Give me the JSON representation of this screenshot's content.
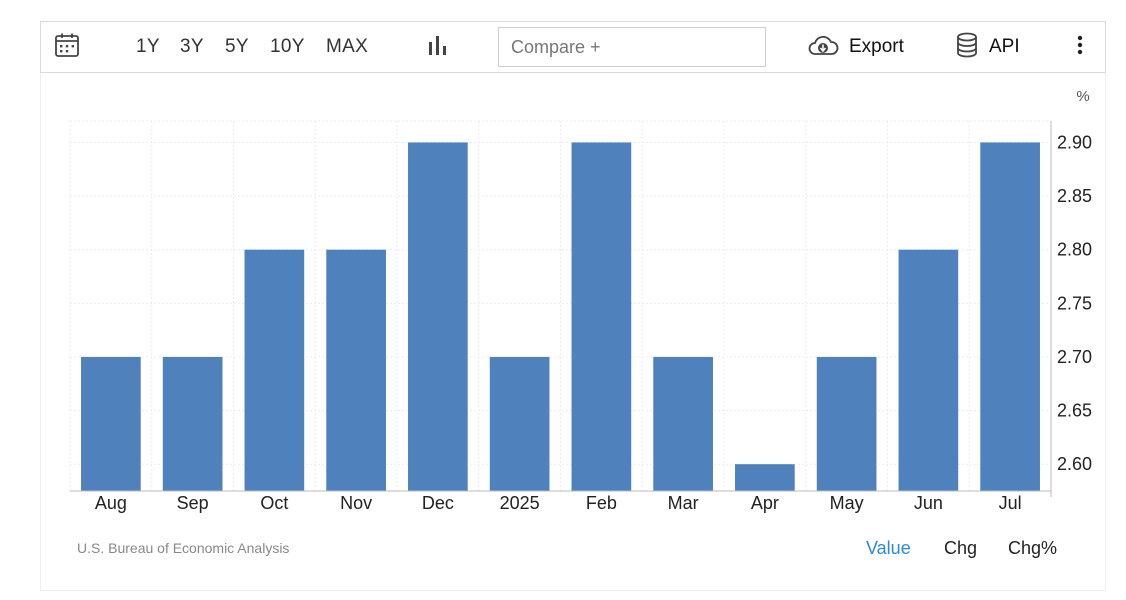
{
  "toolbar": {
    "calendar_icon": "calendar-icon",
    "ranges": [
      "1Y",
      "3Y",
      "5Y",
      "10Y",
      "MAX"
    ],
    "chart_type_icon": "bar-chart-icon",
    "compare_placeholder": "Compare +",
    "export_icon": "cloud-download-icon",
    "export_label": "Export",
    "api_icon": "database-icon",
    "api_label": "API",
    "more_icon": "more-vertical-icon"
  },
  "footer": {
    "source": "U.S. Bureau of Economic Analysis",
    "modes": [
      "Value",
      "Chg",
      "Chg%"
    ],
    "active_mode": "Value"
  },
  "colors": {
    "bar": "#4f81bd",
    "active_mode": "#2b8ad8",
    "grid": "#ececec"
  },
  "chart_data": {
    "type": "bar",
    "categories": [
      "Aug",
      "Sep",
      "Oct",
      "Nov",
      "Dec",
      "2025",
      "Feb",
      "Mar",
      "Apr",
      "May",
      "Jun",
      "Jul"
    ],
    "values": [
      2.7,
      2.7,
      2.8,
      2.8,
      2.9,
      2.7,
      2.9,
      2.7,
      2.6,
      2.7,
      2.8,
      2.9
    ],
    "unit": "%",
    "y_ticks": [
      "2.60",
      "2.65",
      "2.70",
      "2.75",
      "2.80",
      "2.85",
      "2.90"
    ],
    "ylim": [
      2.575,
      2.92
    ],
    "y_axis_position": "right",
    "grid": true,
    "title": "",
    "xlabel": "",
    "ylabel": ""
  }
}
